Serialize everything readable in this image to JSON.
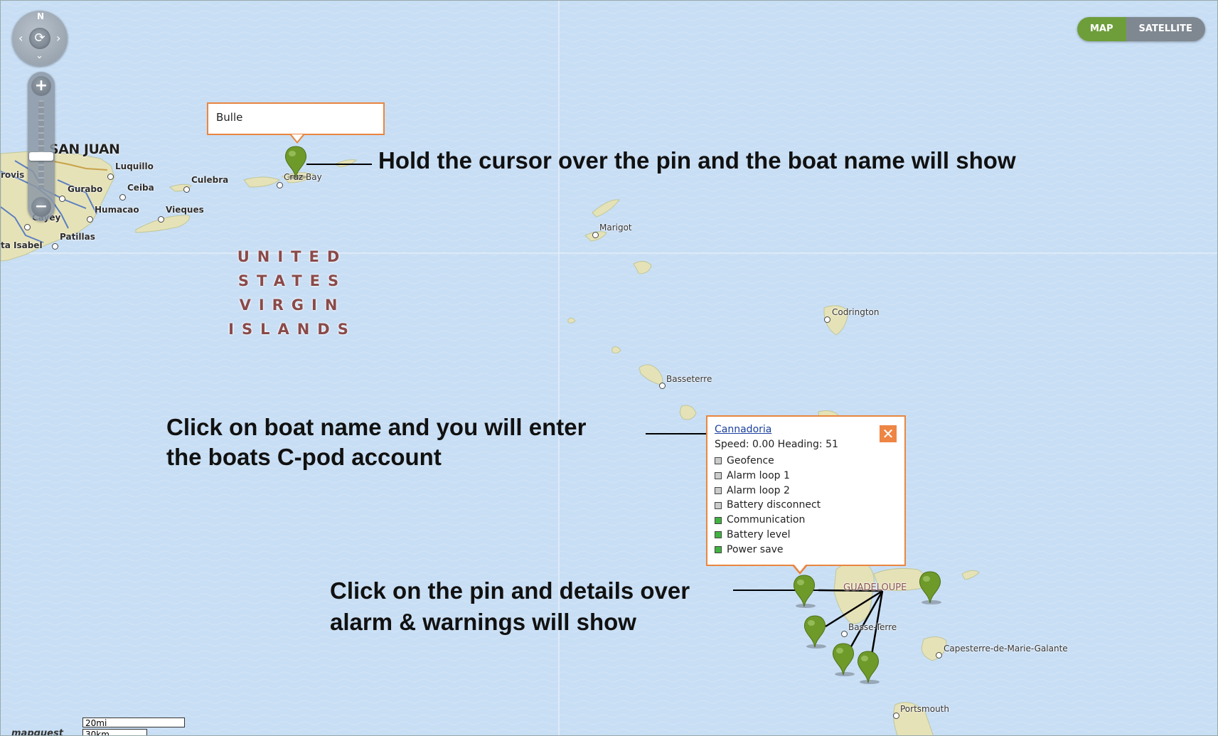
{
  "map_controls": {
    "north_label": "N",
    "maptype": {
      "map_label": "MAP",
      "satellite_label": "SATELLITE",
      "selected": "MAP"
    }
  },
  "places": {
    "san_juan": "SAN JUAN",
    "luquillo": "Luquillo",
    "culebra": "Culebra",
    "cruz_bay": "Cruz Bay",
    "gurabo": "Gurabo",
    "ceiba": "Ceiba",
    "humacao": "Humacao",
    "vieques": "Vieques",
    "cayey": "Cayey",
    "patillas": "Patillas",
    "santa_isabel": "ta Isabel",
    "rovis": "rovis",
    "marigot": "Marigot",
    "codrington": "Codrington",
    "basseterre": "Basseterre",
    "guadeloupe": "GUADELOUPE",
    "basse_terre": "Basse-Terre",
    "capesterre": "Capesterre-de-Marie-Galante",
    "portsmouth": "Portsmouth"
  },
  "region_label": [
    "UNITED",
    "STATES",
    "VIRGIN",
    "ISLANDS"
  ],
  "hover_tooltip": {
    "boat_name": "Bulle"
  },
  "info_popup": {
    "boat_name": "Cannadoria",
    "close_label": "✕",
    "speed_heading": "Speed: 0.00 Heading: 51",
    "items": [
      {
        "label": "Geofence",
        "status": "gray"
      },
      {
        "label": "Alarm loop 1",
        "status": "gray"
      },
      {
        "label": "Alarm loop 2",
        "status": "gray"
      },
      {
        "label": "Battery disconnect",
        "status": "gray"
      },
      {
        "label": "Communication",
        "status": "green"
      },
      {
        "label": "Battery level",
        "status": "green"
      },
      {
        "label": "Power save",
        "status": "green"
      }
    ]
  },
  "annotations": {
    "hover": "Hold the cursor over the pin and the boat name will show",
    "click_name_1": "Click on boat name and you will enter",
    "click_name_2": "the boats C-pod account",
    "click_pin_1": "Click on the pin and details over",
    "click_pin_2": "alarm & warnings will show"
  },
  "scale": {
    "miles": "20mi",
    "km": "30km"
  },
  "attribution": "mapquest",
  "colors": {
    "sea": "#c8def4",
    "land": "#e6e2b8",
    "pin": "#6e9a2a",
    "popup_border": "#e9863f",
    "status_gray": "#cccccc",
    "status_green": "#3fb33f"
  }
}
